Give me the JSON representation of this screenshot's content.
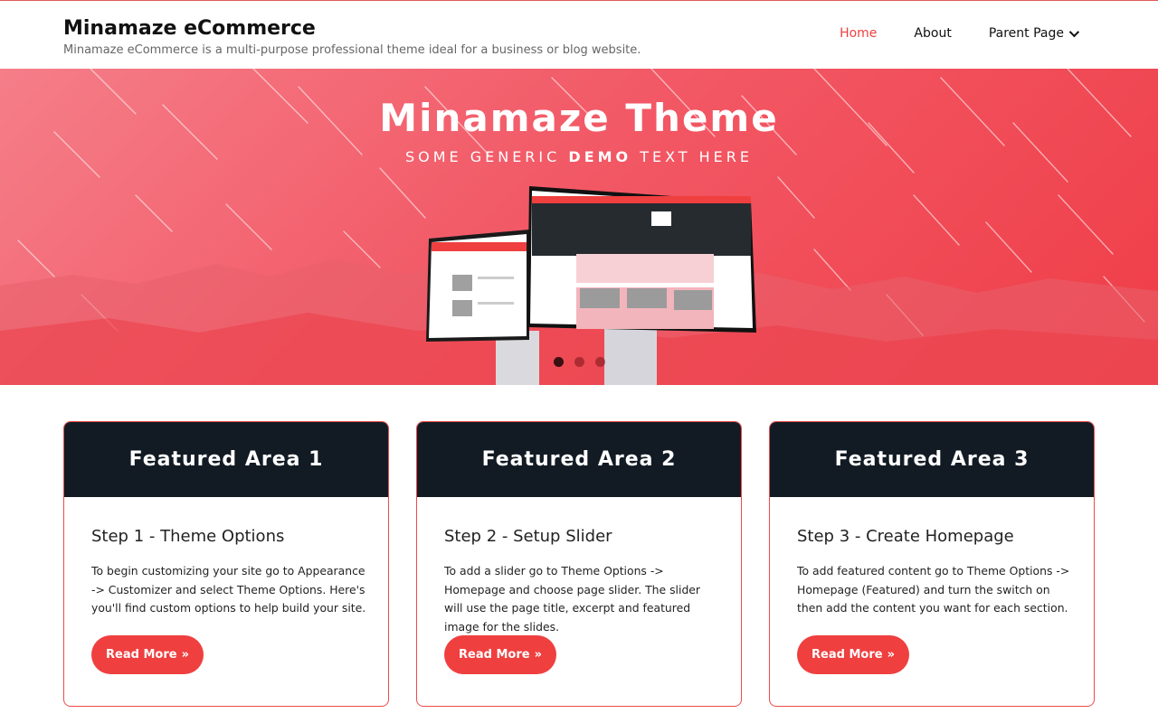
{
  "site": {
    "title": "Minamaze eCommerce",
    "description": "Minamaze eCommerce is a multi-purpose professional theme ideal for a business or blog website."
  },
  "nav": {
    "items": [
      {
        "label": "Home",
        "active": true
      },
      {
        "label": "About",
        "active": false
      },
      {
        "label": "Parent Page",
        "active": false,
        "icon": "chevron-down-icon"
      }
    ]
  },
  "hero": {
    "title": "Minamaze  Theme",
    "subtitle_pre": "SOME GENERIC ",
    "subtitle_bold": "DEMO",
    "subtitle_post": " TEXT HERE",
    "slide_count": 3,
    "active_slide": 1
  },
  "cards": [
    {
      "heading": "Featured Area 1",
      "title": "Step 1 - Theme Options",
      "text": "To begin customizing your site go to Appearance -> Customizer and select Theme Options. Here's you'll find custom options to help build your site.",
      "button": "Read More"
    },
    {
      "heading": "Featured Area 2",
      "title": "Step 2 - Setup Slider",
      "text": "To add a slider go to Theme Options -> Homepage and choose page slider. The slider will use the page title, excerpt and featured image for the slides.",
      "button": "Read More"
    },
    {
      "heading": "Featured Area 3",
      "title": "Step 3 - Create Homepage",
      "text": "To add featured content go to Theme Options -> Homepage (Featured) and turn the switch on then add the content you want for each section.",
      "button": "Read More"
    }
  ],
  "colors": {
    "accent": "#ef3f3f",
    "card_header": "#121b24",
    "hero_light": "#f57e89",
    "hero_dark": "#ef3d47"
  },
  "icons": {
    "read_more_arrow": "double-chevron-right-icon"
  }
}
